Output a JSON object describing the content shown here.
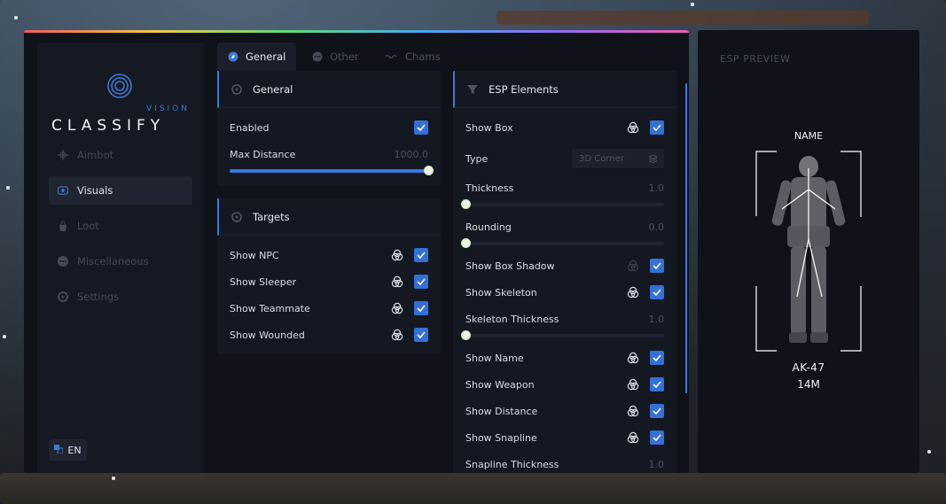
{
  "logo": {
    "sub": "VISION",
    "brand": "CLASSIFY"
  },
  "sidebar": {
    "items": [
      {
        "label": "Aimbot",
        "icon": "crosshair-icon",
        "active": false
      },
      {
        "label": "Visuals",
        "icon": "eye-icon",
        "active": true
      },
      {
        "label": "Loot",
        "icon": "bag-icon",
        "active": false
      },
      {
        "label": "Miscellaneous",
        "icon": "dots-icon",
        "active": false
      },
      {
        "label": "Settings",
        "icon": "gear-icon",
        "active": false
      }
    ],
    "language": "EN"
  },
  "tabs": [
    {
      "label": "General",
      "active": true
    },
    {
      "label": "Other",
      "active": false
    },
    {
      "label": "Chams",
      "active": false
    }
  ],
  "general": {
    "title": "General",
    "enabled_label": "Enabled",
    "enabled": true,
    "max_distance_label": "Max Distance",
    "max_distance_value": "1000.0",
    "max_distance_fraction": 1.0
  },
  "targets": {
    "title": "Targets",
    "items": [
      {
        "label": "Show NPC",
        "checked": true
      },
      {
        "label": "Show Sleeper",
        "checked": true
      },
      {
        "label": "Show Teammate",
        "checked": true
      },
      {
        "label": "Show Wounded",
        "checked": true
      }
    ]
  },
  "esp": {
    "title": "ESP Elements",
    "show_box": "Show Box",
    "type_label": "Type",
    "type_value": "3D Corner",
    "thickness_label": "Thickness",
    "thickness_value": "1.0",
    "thickness_fraction": 0.0,
    "rounding_label": "Rounding",
    "rounding_value": "0.0",
    "rounding_fraction": 0.0,
    "show_box_shadow": "Show Box Shadow",
    "show_skeleton": "Show Skeleton",
    "skeleton_thickness_label": "Skeleton Thickness",
    "skeleton_thickness_value": "1.0",
    "skeleton_thickness_fraction": 0.0,
    "show_name": "Show Name",
    "show_weapon": "Show Weapon",
    "show_distance": "Show Distance",
    "show_snapline": "Show Snapline",
    "snapline_thickness_label": "Snapline Thickness",
    "snapline_thickness_value": "1.0"
  },
  "preview": {
    "title": "ESP PREVIEW",
    "name": "NAME",
    "weapon": "AK-47",
    "distance": "14M"
  },
  "colors": {
    "accent": "#3570d6",
    "panel": "#141821",
    "window": "#0f1218"
  }
}
